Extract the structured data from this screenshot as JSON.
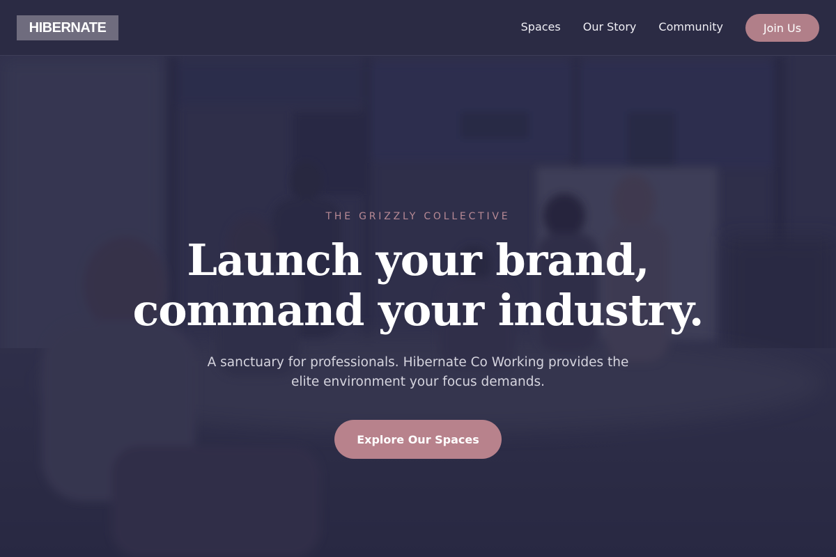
{
  "brand": {
    "logo_text": "HIBERNATE"
  },
  "nav": {
    "links": [
      {
        "label": "Spaces"
      },
      {
        "label": "Our Story"
      },
      {
        "label": "Community"
      }
    ],
    "cta_label": "Join Us"
  },
  "hero": {
    "eyebrow": "THE GRIZZLY COLLECTIVE",
    "headline_line1": "Launch your brand,",
    "headline_line2": "command your industry.",
    "subtext_line1": "A sanctuary for professionals. Hibernate Co Working provides the",
    "subtext_line2": "elite environment your focus demands.",
    "cta_label": "Explore Our Spaces",
    "background_image": "blurred-office-meeting-photo"
  },
  "colors": {
    "nav_background": "#2b2b44",
    "accent": "#b8828c",
    "eyebrow": "#b88a95",
    "hero_overlay": "#262640"
  }
}
